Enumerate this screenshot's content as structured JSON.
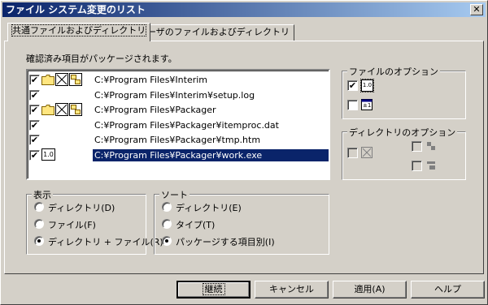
{
  "window": {
    "title": "ファイル システム変更のリスト",
    "close_glyph": "✕"
  },
  "tabs": [
    {
      "label": "共通ファイルおよびディレクトリ"
    },
    {
      "label": "ユーザのファイルおよびディレクトリ"
    }
  ],
  "confirmed_label": "確認済み項目がパッケージされます。",
  "list": {
    "rows": [
      {
        "checked": true,
        "path": "C:¥Program Files¥Interim",
        "icons": "folder",
        "selected": false
      },
      {
        "checked": true,
        "path": "C:¥Program Files¥Interim¥setup.log",
        "icons": "",
        "selected": false
      },
      {
        "checked": true,
        "path": "C:¥Program Files¥Packager",
        "icons": "folder",
        "selected": false
      },
      {
        "checked": true,
        "path": "C:¥Program Files¥Packager¥itemproc.dat",
        "icons": "",
        "selected": false
      },
      {
        "checked": true,
        "path": "C:¥Program Files¥Packager¥tmp.htm",
        "icons": "",
        "selected": false
      },
      {
        "checked": true,
        "path": "C:¥Program Files¥Packager¥work.exe",
        "icons": "version",
        "selected": true
      }
    ],
    "check_glyph": "✔",
    "version_text": "1.0"
  },
  "file_options": {
    "title": "ファイルのオプション",
    "version_text": "1.0",
    "version_checked": true,
    "date_checked": false,
    "date_text": "±1"
  },
  "dir_options": {
    "title": "ディレクトリのオプション"
  },
  "display": {
    "title": "表示",
    "options": [
      "ディレクトリ(D)",
      "ファイル(F)",
      "ディレクトリ + ファイル(R)"
    ],
    "selected": 2
  },
  "sort": {
    "title": "ソート",
    "options": [
      "ディレクトリ(E)",
      "タイプ(T)",
      "パッケージする項目別(I)"
    ],
    "selected": 2
  },
  "buttons": {
    "continue": "継続",
    "cancel": "キャンセル",
    "apply": "適用(A)",
    "help": "ヘルプ"
  }
}
